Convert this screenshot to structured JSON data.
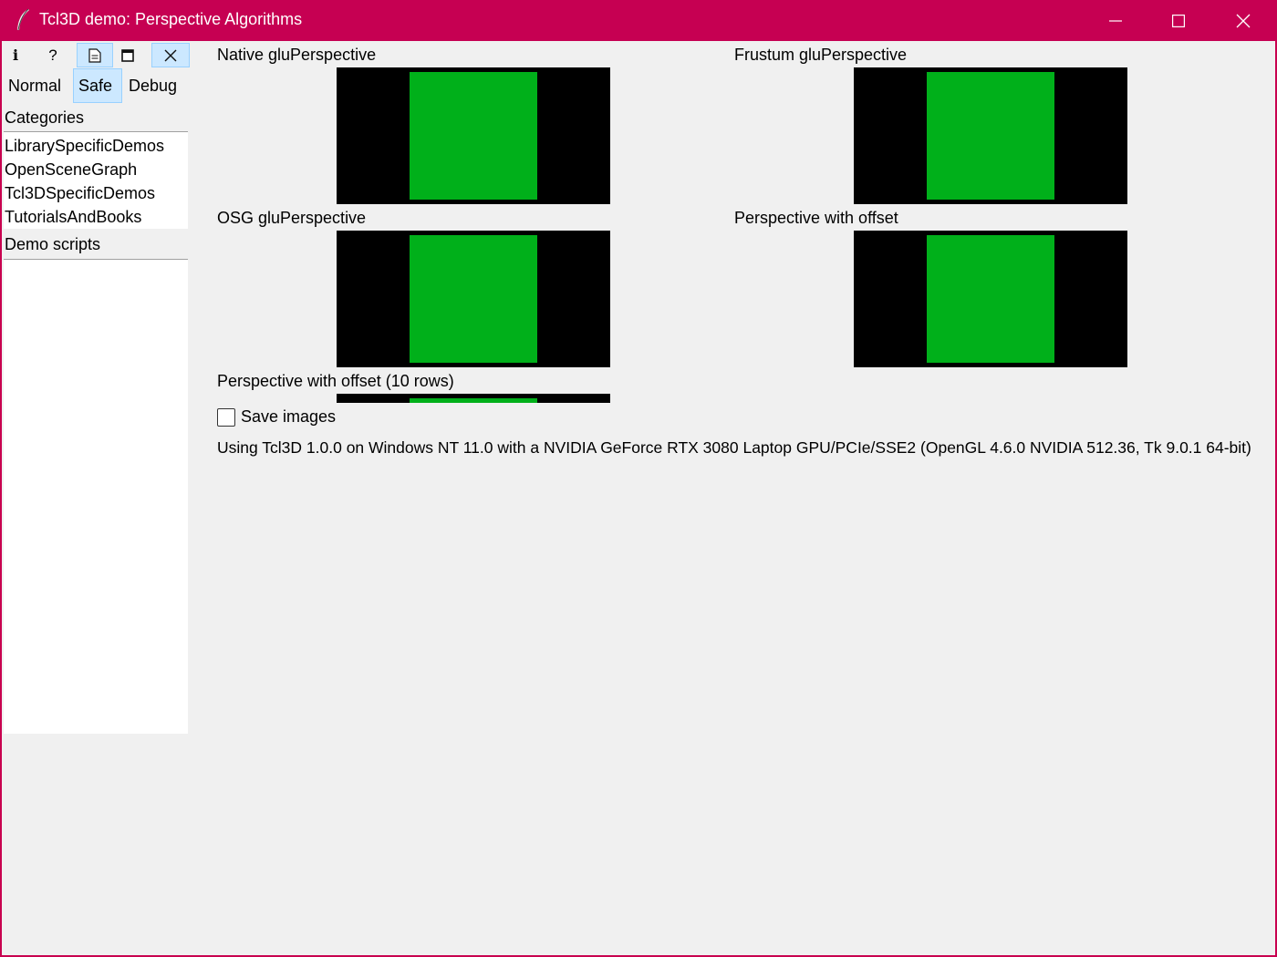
{
  "window": {
    "title": "Tcl3D demo: Perspective Algorithms"
  },
  "toolbar": {
    "info_glyph": "i",
    "help_glyph": "?"
  },
  "modes": {
    "normal": "Normal",
    "safe": "Safe",
    "debug": "Debug",
    "selected": "Safe"
  },
  "sidebar": {
    "categories_label": "Categories",
    "categories": [
      "LibrarySpecificDemos",
      "OpenSceneGraph",
      "Tcl3DSpecificDemos",
      "TutorialsAndBooks"
    ],
    "demo_scripts_label": "Demo scripts"
  },
  "panels": {
    "native": "Native gluPerspective",
    "frustum": "Frustum gluPerspective",
    "osg": "OSG gluPerspective",
    "offset": "Perspective with offset",
    "offset_rows": "Perspective with offset (10 rows)"
  },
  "options": {
    "save_images_label": "Save images",
    "save_images_checked": false
  },
  "status": {
    "info": "Using Tcl3D 1.0.0 on Windows NT 11.0 with a NVIDIA GeForce RTX 3080 Laptop GPU/PCIe/SSE2 (OpenGL 4.6.0 NVIDIA 512.36, Tk 9.0.1 64-bit)"
  },
  "colors": {
    "titlebar": "#c60052",
    "render_square": "#00b01a",
    "render_background": "#000000",
    "selected_highlight": "#cce8ff"
  }
}
